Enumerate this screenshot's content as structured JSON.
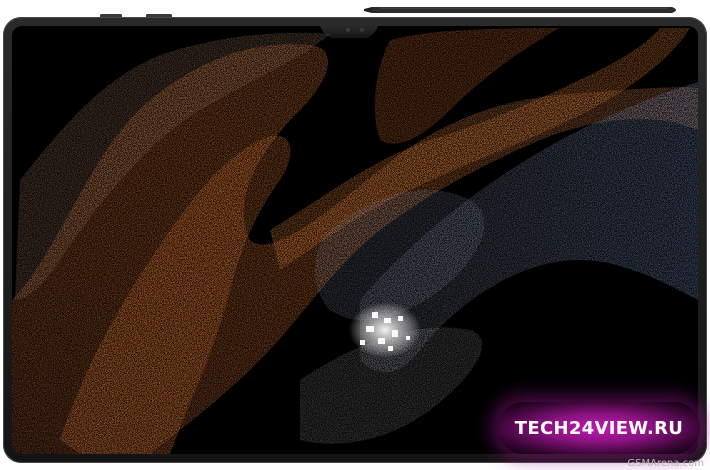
{
  "watermark": {
    "text": "TECH24VIEW.RU",
    "color": "#c21bb1"
  },
  "credit": {
    "text": "GSMArena.com"
  },
  "device": {
    "bezel_color": "#1b1b1c",
    "screen_color": "#000000"
  },
  "artwork": {
    "particle_colors": [
      "#e07a35",
      "#c9896a",
      "#8fa6d6",
      "#ffffff"
    ]
  }
}
